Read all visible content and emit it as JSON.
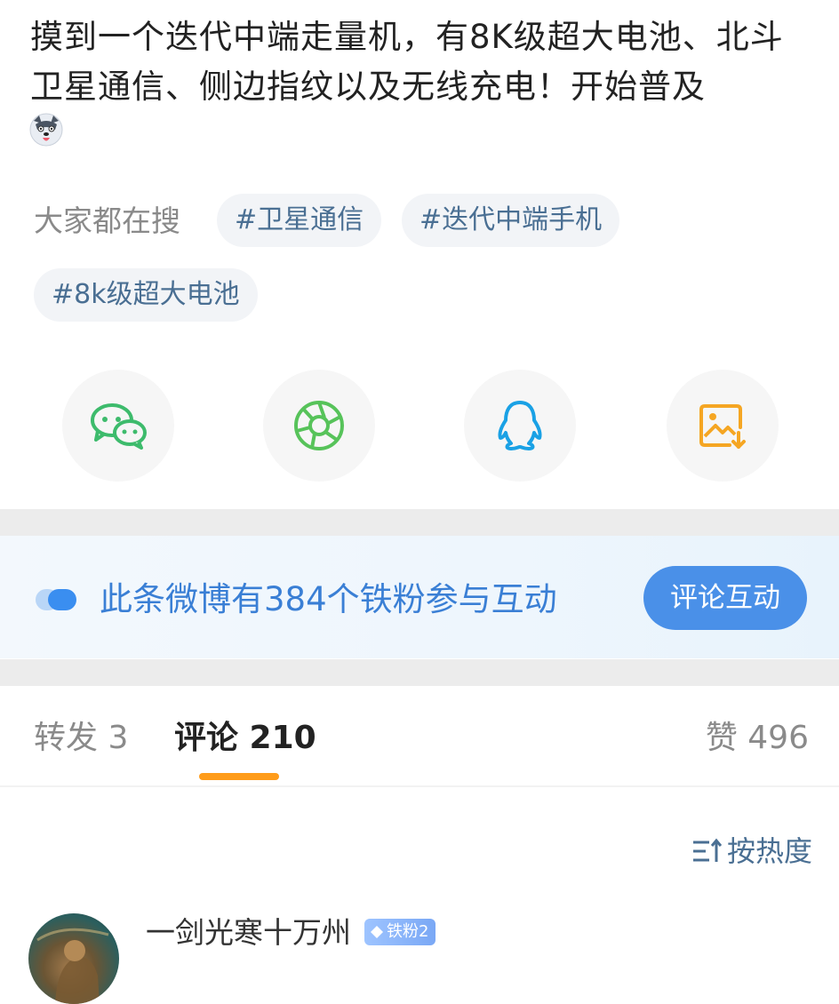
{
  "post": {
    "text": "摸到一个迭代中端走量机，有8K级超大电池、北斗卫星通信、侧边指纹以及无线充电！开始普及",
    "emoji_icon": "husky-dog-emoji"
  },
  "search": {
    "label": "大家都在搜",
    "tags": [
      "#卫星通信",
      "#迭代中端手机",
      "#8k级超大电池"
    ]
  },
  "share": {
    "items": [
      {
        "icon": "wechat-icon",
        "color": "#3dbb6c"
      },
      {
        "icon": "moments-aperture-icon",
        "color": "#57c35a"
      },
      {
        "icon": "qq-penguin-icon",
        "color": "#1aa1e5"
      },
      {
        "icon": "save-image-icon",
        "color": "#f5a623"
      }
    ]
  },
  "fan_banner": {
    "text": "此条微博有384个铁粉参与互动",
    "button": "评论互动"
  },
  "tabs": {
    "repost": "转发 3",
    "comment": "评论 210",
    "like": "赞 496"
  },
  "sort": {
    "label": "按热度"
  },
  "comment": {
    "username": "一剑光寒十万州",
    "badge": "铁粉2"
  },
  "colors": {
    "accent_blue": "#4a90e8",
    "tag_text": "#4a6f93",
    "tab_underline": "#ff9c1a"
  }
}
